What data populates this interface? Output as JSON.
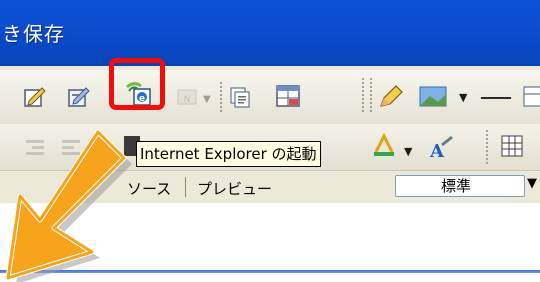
{
  "window": {
    "title": "き保存"
  },
  "toolbar": {
    "tooltip_text": "Internet Explorer の起動",
    "view_tabs": [
      "ソース",
      "プレビュー"
    ],
    "style_combo_value": "標準"
  },
  "colors": {
    "title_bar": "#0a4ecc",
    "toolbar_bg": "#ece9d8",
    "highlight_frame": "#f20d0d",
    "tooltip_bg": "#ffffe1",
    "pointer_arrow": "#f7a31c"
  },
  "icons": [
    "edit-icon",
    "edit-alt-icon",
    "internet-explorer-icon",
    "disabled-icon",
    "copy-icon",
    "table-icon",
    "pencil-icon",
    "image-icon",
    "horizontal-rule-icon",
    "grid-icon",
    "text-color-icon",
    "font-icon",
    "pointer-arrow-icon"
  ]
}
